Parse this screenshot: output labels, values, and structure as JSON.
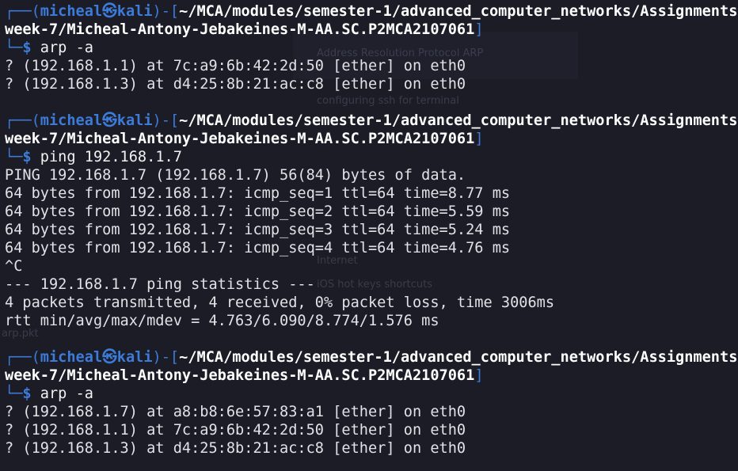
{
  "prompt": {
    "user": "micheal",
    "separator_glyph": "㉿",
    "host": "kali",
    "path_line1": "~/MCA/modules/semester-1/advanced_computer_networks/Assignments/",
    "path_line2": "week-7/Micheal-Antony-Jebakeines-M-AA.SC.P2MCA2107061",
    "symbol": "$"
  },
  "blocks": [
    {
      "command": "arp -a",
      "output": [
        "? (192.168.1.1) at 7c:a9:6b:42:2d:50 [ether] on eth0",
        "? (192.168.1.3) at d4:25:8b:21:ac:c8 [ether] on eth0"
      ]
    },
    {
      "command": "ping 192.168.1.7",
      "output": [
        "PING 192.168.1.7 (192.168.1.7) 56(84) bytes of data.",
        "64 bytes from 192.168.1.7: icmp_seq=1 ttl=64 time=8.77 ms",
        "64 bytes from 192.168.1.7: icmp_seq=2 ttl=64 time=5.59 ms",
        "64 bytes from 192.168.1.7: icmp_seq=3 ttl=64 time=5.24 ms",
        "64 bytes from 192.168.1.7: icmp_seq=4 ttl=64 time=4.76 ms",
        "^C",
        "--- 192.168.1.7 ping statistics ---",
        "4 packets transmitted, 4 received, 0% packet loss, time 3006ms",
        "rtt min/avg/max/mdev = 4.763/6.090/8.774/1.576 ms"
      ]
    },
    {
      "command": "arp -a",
      "output": [
        "? (192.168.1.7) at a8:b8:6e:57:83:a1 [ether] on eth0",
        "? (192.168.1.1) at 7c:a9:6b:42:2d:50 [ether] on eth0",
        "? (192.168.1.3) at d4:25:8b:21:ac:c8 [ether] on eth0"
      ]
    }
  ],
  "background_ghost_text": [
    "Address Resolution Protocol ARP",
    "configuring ssh for terminal",
    "Internet",
    "iOS hot keys shortcuts",
    "arp.pkt"
  ],
  "colors": {
    "background": "#1b1c26",
    "prompt_blue": "#3d7bd9",
    "text": "#e2e2e6"
  }
}
